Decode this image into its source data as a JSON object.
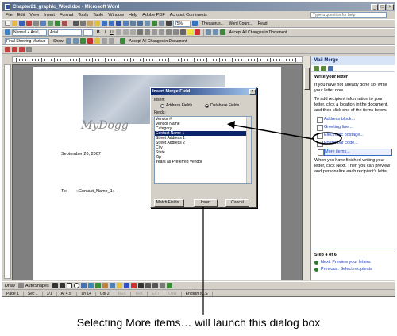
{
  "window": {
    "title": "Chapter21_graphic_Word.doc - Microsoft Word"
  },
  "menu": [
    "File",
    "Edit",
    "View",
    "Insert",
    "Format",
    "Tools",
    "Table",
    "Window",
    "Help",
    "Adobe PDF",
    "Acrobat Comments"
  ],
  "help_box": {
    "placeholder": "Type a question for help"
  },
  "standard_toolbar": {
    "zoom": "75%",
    "thesaurus": "Thesaurus...",
    "word_count": "Word Count...",
    "read": "Read"
  },
  "formatting_toolbar": {
    "style": "Normal + Arial,",
    "font": "Arial",
    "accept_label": "Accept All Changes in Document"
  },
  "reviewing_toolbar": {
    "markup_mode": "Final Showing Markup",
    "show": "Show",
    "accept_label": "Accept All Changes in Document"
  },
  "document": {
    "letterhead": "MyDogg",
    "date": "September 26, 2007",
    "to_label": "To:",
    "merge_field": "«Contact_Name_1»"
  },
  "dialog": {
    "title": "Insert Merge Field",
    "insert_label": "Insert:",
    "radio_address": "Address Fields",
    "radio_database": "Database Fields",
    "fields_label": "Fields:",
    "fields": [
      "Vendor #",
      "Vendor Name",
      "Category",
      "Contact Name 1",
      "Street Address 1",
      "Street Address 2",
      "City",
      "State",
      "Zip",
      "Years as Preferred Vendor"
    ],
    "selected_field": "Contact Name 1",
    "match_button": "Match Fields...",
    "insert_button": "Insert",
    "cancel_button": "Cancel"
  },
  "task_pane": {
    "title": "Mail Merge",
    "section": "Write your letter",
    "intro": "If you have not already done so, write your letter now.",
    "instructions": "To add recipient information to your letter, click a location in the document, and then click one of the items below.",
    "items": [
      "Address block...",
      "Greeting line...",
      "Electronic postage...",
      "Postal bar code...",
      "More items..."
    ],
    "after_text": "When you have finished writing your letter, click Next. Then you can preview and personalize each recipient's letter.",
    "step": "Step 4 of 6",
    "next": "Next: Preview your letters",
    "previous": "Previous: Select recipients"
  },
  "drawing_toolbar": {
    "draw": "Draw",
    "autoshapes": "AutoShapes"
  },
  "status_bar": [
    "Page 1",
    "Sec 1",
    "1/1",
    "At 4.5\"",
    "Ln 14",
    "Col 2",
    "REC",
    "TRK",
    "EXT",
    "OVR",
    "English (U.S"
  ],
  "caption": "Selecting More items… will launch this dialog box"
}
